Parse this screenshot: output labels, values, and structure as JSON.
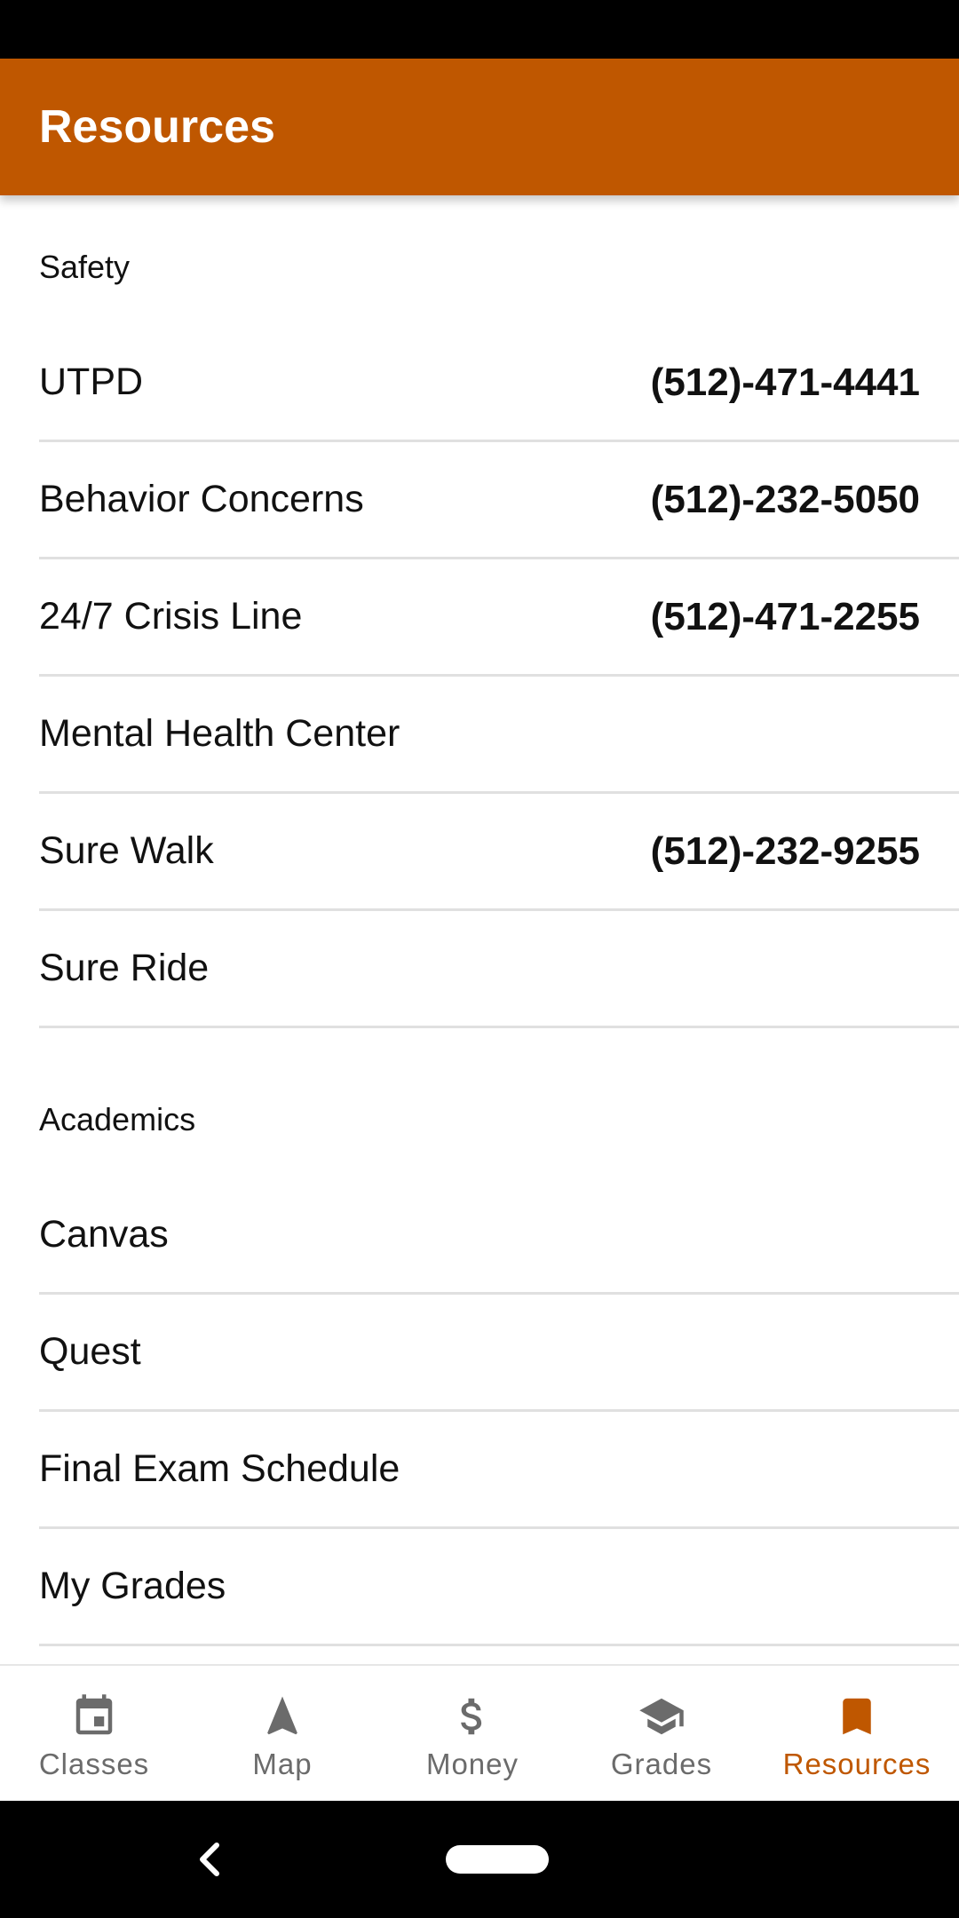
{
  "app": {
    "title": "Resources",
    "accent_color": "#bf5700"
  },
  "sections": [
    {
      "header": "Safety",
      "items": [
        {
          "label": "UTPD",
          "phone": "(512)-471-4441"
        },
        {
          "label": "Behavior Concerns",
          "phone": "(512)-232-5050"
        },
        {
          "label": "24/7 Crisis Line",
          "phone": "(512)-471-2255"
        },
        {
          "label": "Mental Health Center",
          "phone": ""
        },
        {
          "label": "Sure Walk",
          "phone": "(512)-232-9255"
        },
        {
          "label": "Sure Ride",
          "phone": ""
        }
      ]
    },
    {
      "header": "Academics",
      "items": [
        {
          "label": "Canvas"
        },
        {
          "label": "Quest"
        },
        {
          "label": "Final Exam Schedule"
        },
        {
          "label": "My Grades"
        }
      ]
    }
  ],
  "bottom_nav": {
    "items": [
      {
        "label": "Classes",
        "icon": "calendar-icon"
      },
      {
        "label": "Map",
        "icon": "navigation-arrow-icon"
      },
      {
        "label": "Money",
        "icon": "dollar-icon"
      },
      {
        "label": "Grades",
        "icon": "graduation-cap-icon"
      },
      {
        "label": "Resources",
        "icon": "bookmark-icon",
        "active": true
      }
    ]
  }
}
